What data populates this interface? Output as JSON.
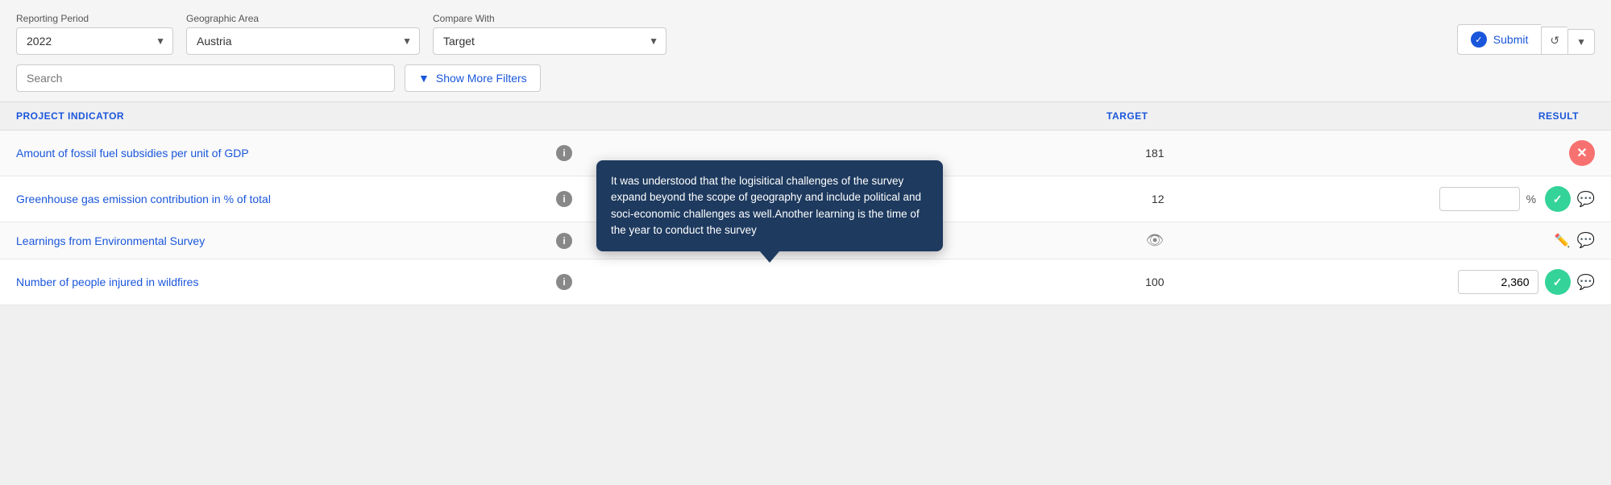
{
  "topbar": {
    "reporting_period_label": "Reporting Period",
    "reporting_period_value": "2022",
    "geographic_area_label": "Geographic Area",
    "geographic_area_value": "Austria",
    "compare_with_label": "Compare With",
    "compare_with_value": "Target",
    "submit_label": "Submit",
    "search_placeholder": "Search",
    "show_filters_label": "Show More Filters"
  },
  "table": {
    "col_project_indicator": "PROJECT INDICATOR",
    "col_target": "TARGET",
    "col_result": "RESULT",
    "rows": [
      {
        "name": "Amount of fossil fuel subsidies per unit of GDP",
        "target": "181",
        "result_value": "",
        "result_unit": "",
        "status": "red",
        "has_comment": false,
        "has_eye": false,
        "has_pencil": false
      },
      {
        "name": "Greenhouse gas emission contribution in % of total",
        "target": "12",
        "result_value": "",
        "result_unit": "%",
        "status": "green",
        "has_comment": true,
        "has_eye": false,
        "has_pencil": false,
        "tooltip": "It was understood that the logisitical challenges of the survey expand beyond the scope of geography and include political and soci-economic challenges as well.Another learning is the time of the year to conduct the survey"
      },
      {
        "name": "Learnings from Environmental Survey",
        "target": "",
        "result_value": "",
        "result_unit": "",
        "status": "none",
        "has_comment": true,
        "has_eye": true,
        "has_pencil": true
      },
      {
        "name": "Number of people injured in wildfires",
        "target": "100",
        "result_value": "2,360",
        "result_unit": "",
        "status": "green",
        "has_comment": true,
        "has_eye": false,
        "has_pencil": false
      }
    ]
  }
}
